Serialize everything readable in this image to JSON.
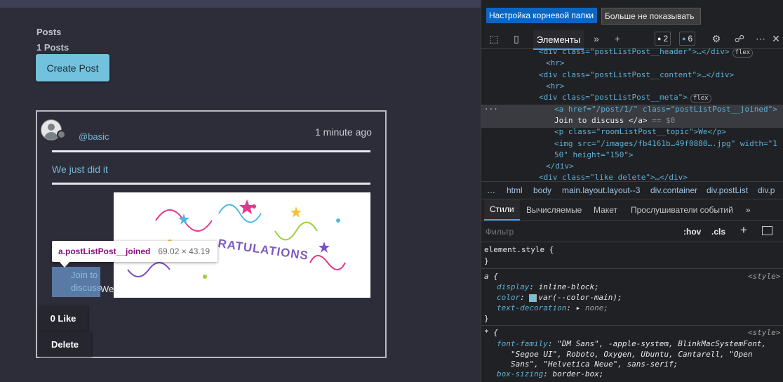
{
  "app": {
    "posts_heading": "Posts",
    "posts_count": "1 Posts",
    "create_button": "Create Post",
    "post": {
      "username": "@basic",
      "time": "1 minute ago",
      "content": "We just did it",
      "image_text": "RATULATIONS",
      "joined_link": "Join to discuss",
      "topic": "We",
      "like_button": "0 Like",
      "delete_button": "Delete"
    },
    "inspect_tooltip": {
      "selector": "a.postListPost__joined",
      "size": "69.02 × 43.19"
    }
  },
  "devtools": {
    "banner": {
      "primary": "Настройка корневой папки",
      "secondary": "Больше не показывать"
    },
    "tabs": {
      "elements": "Элементы"
    },
    "badges": {
      "errors": "2",
      "messages": "6"
    },
    "dom_lines": {
      "l1_tag": "<div class=\"postListPost__header\">…</div>",
      "l2": "<hr>",
      "l3_tag": "<div class=\"postListPost__content\">…</div>",
      "l4": "<hr>",
      "l5_tag": "<div class=\"postListPost__meta\">",
      "l6": "<a href=\"/post/1/\" class=\"postListPost__joined\">",
      "l7": "Join to discuss </a>",
      "l7_eq": "== $0",
      "l8": "<p class=\"roomListPost__topic\">We</p>",
      "l9": "<img src=\"/images/fb4161b…49f0880….jpg\" width=\"1",
      "l10": "50\" height=\"150\">",
      "l11": "</div>",
      "l12": "<div class=\"like_delete\">…</div>",
      "flex": "flex",
      "ellipsis": "···"
    },
    "breadcrumb": [
      "…",
      "html",
      "body",
      "main.layout.layout--3",
      "div.container",
      "div.postList",
      "div.p"
    ],
    "style_tabs": [
      "Стили",
      "Вычисляемые",
      "Макет",
      "Прослушиватели событий",
      "»"
    ],
    "filter": {
      "placeholder": "Фильтр",
      "hov": ":hov",
      "cls": ".cls"
    },
    "styles": {
      "element_style": "element.style {",
      "close": "}",
      "a_sel": "a {",
      "source": "<style>",
      "display_prop": "display",
      "display_val": "inline-block;",
      "color_prop": "color",
      "color_val": "var(--color-main);",
      "td_prop": "text-decoration",
      "td_val": "none;",
      "star_sel": "* {",
      "ff_prop": "font-family",
      "ff_val1": "\"DM Sans\", -apple-system, BlinkMacSystemFont,",
      "ff_val2": "\"Segoe UI\", Roboto, Oxygen, Ubuntu, Cantarell, \"Open",
      "ff_val3": "Sans\", \"Helvetica Neue\", sans-serif;",
      "bs_prop": "box-sizing",
      "bs_val": "border-box;"
    },
    "colors": {
      "accent": "#4b9ff0",
      "color_swatch": "#73c2dd"
    }
  }
}
